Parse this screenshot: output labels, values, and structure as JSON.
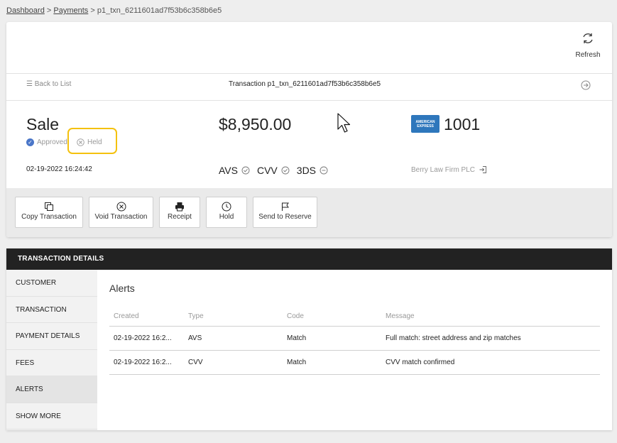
{
  "breadcrumb": {
    "dashboard": "Dashboard",
    "sep1": " > ",
    "payments": "Payments",
    "sep2": " > ",
    "current": "p1_txn_6211601ad7f53b6c358b6e5"
  },
  "toolbar": {
    "refresh_label": "Refresh"
  },
  "nav": {
    "back_label": "Back to List",
    "transaction_title": "Transaction p1_txn_6211601ad7f53b6c358b6e5"
  },
  "summary": {
    "type": "Sale",
    "status_approved": "Approved",
    "status_held": "Held",
    "date": "02-19-2022 16:24:42",
    "amount": "$8,950.00",
    "checks": [
      "AVS",
      "CVV",
      "3DS"
    ],
    "card_brand": "AMERICAN EXPRESS",
    "card_last4": "1001",
    "merchant": "Berry Law Firm PLC"
  },
  "actions": {
    "copy": "Copy Transaction",
    "void": "Void Transaction",
    "receipt": "Receipt",
    "hold": "Hold",
    "reserve": "Send to Reserve"
  },
  "details": {
    "header": "TRANSACTION DETAILS",
    "sidebar": [
      "CUSTOMER",
      "TRANSACTION",
      "PAYMENT DETAILS",
      "FEES",
      "ALERTS",
      "SHOW MORE"
    ],
    "active_item": "ALERTS",
    "alerts_title": "Alerts",
    "columns": [
      "Created",
      "Type",
      "Code",
      "Message"
    ],
    "rows": [
      [
        "02-19-2022 16:2...",
        "AVS",
        "Match",
        "Full match: street address and zip matches"
      ],
      [
        "02-19-2022 16:2...",
        "CVV",
        "Match",
        "CVV match confirmed"
      ]
    ]
  },
  "colors": {
    "accent_highlight": "#f4c10d",
    "approved_blue": "#4a76c8",
    "amex_blue": "#2e77bc",
    "header_dark": "#222222"
  }
}
